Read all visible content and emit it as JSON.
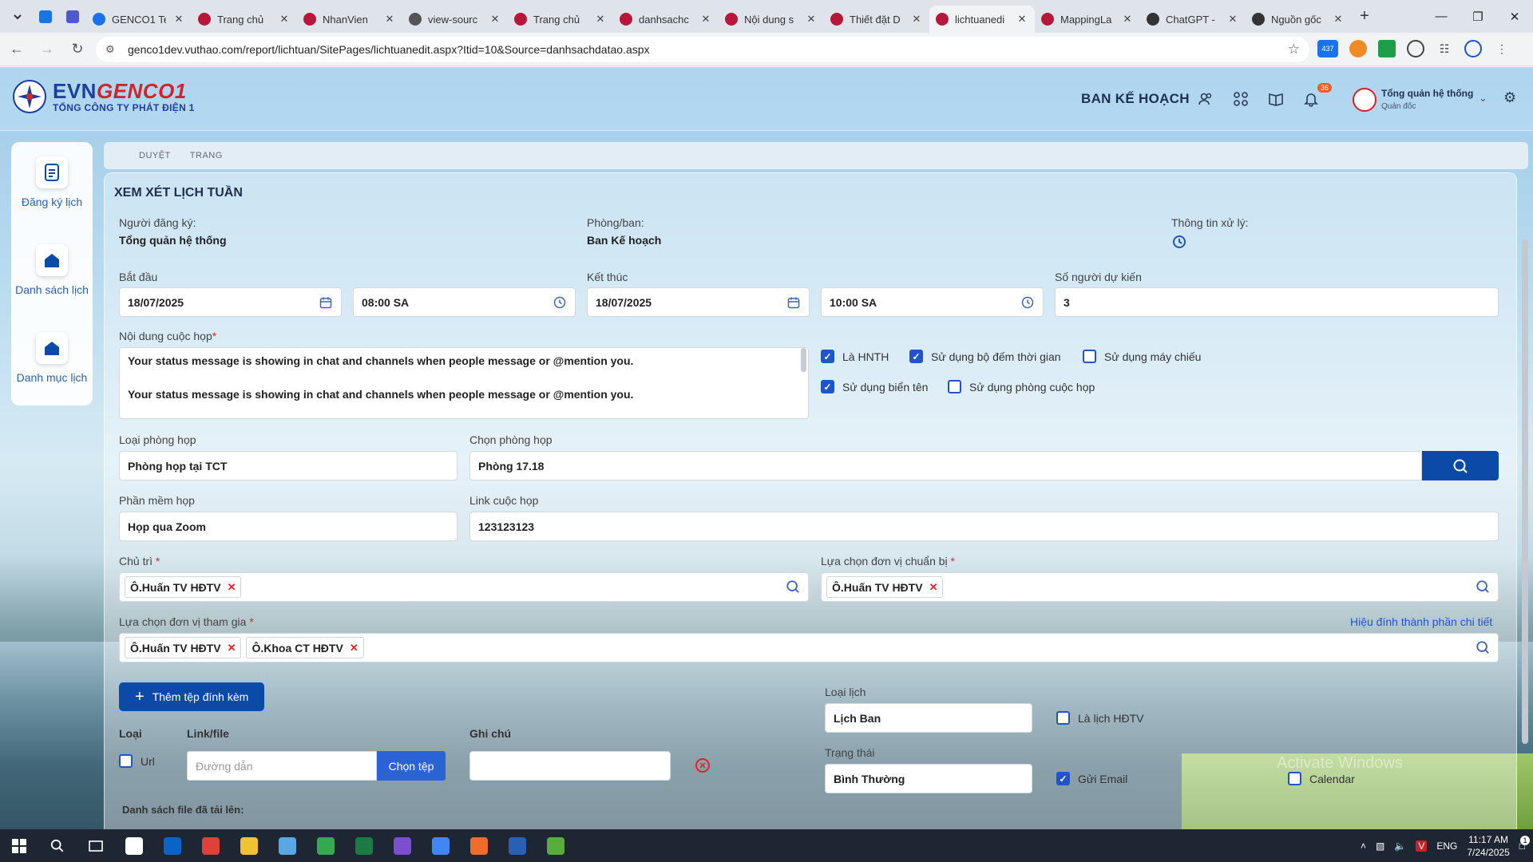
{
  "browser": {
    "tabs": [
      {
        "label": "GENCO1 Te",
        "color": "#1a73e8"
      },
      {
        "label": "Trang chủ",
        "color": "#b7183a"
      },
      {
        "label": "NhanVien",
        "color": "#b7183a"
      },
      {
        "label": "view-sourc",
        "color": "#555555"
      },
      {
        "label": "Trang chủ",
        "color": "#b7183a"
      },
      {
        "label": "danhsachc",
        "color": "#b7183a"
      },
      {
        "label": "Nội dung s",
        "color": "#b7183a"
      },
      {
        "label": "Thiết đặt D",
        "color": "#b7183a"
      },
      {
        "label": "lichtuanedi",
        "color": "#b7183a",
        "active": true
      },
      {
        "label": "MappingLa",
        "color": "#b7183a"
      },
      {
        "label": "ChatGPT -",
        "color": "#333333"
      },
      {
        "label": "Nguồn gốc",
        "color": "#333333"
      }
    ],
    "url": "genco1dev.vuthao.com/report/lichtuan/SitePages/lichtuanedit.aspx?Itid=10&Source=danhsachdatao.aspx",
    "ext_badge": "437"
  },
  "header": {
    "logo_main": "EVN",
    "logo_accent": "GENCO1",
    "logo_sub": "TỔNG CÔNG TY PHÁT ĐIỆN 1",
    "dept_title": "BAN KẾ HOẠCH",
    "notif_count": "36",
    "user_name": "Tổng quản hệ thống",
    "user_role": "Quản đốc"
  },
  "sidebar": {
    "items": [
      {
        "label": "Đăng ký lịch",
        "icon": "document-icon"
      },
      {
        "label": "Danh sách lịch",
        "icon": "home-icon"
      },
      {
        "label": "Danh mục lịch",
        "icon": "home-icon"
      }
    ]
  },
  "breadcrumb": [
    "DUYỆT",
    "TRANG"
  ],
  "form": {
    "title": "XEM XÉT LỊCH TUẦN",
    "registrant_label": "Người đăng ký:",
    "registrant_value": "Tổng quản hệ thống",
    "dept_label": "Phòng/ban:",
    "dept_value": "Ban Kế hoạch",
    "process_label": "Thông tin xử lý:",
    "start_label": "Bắt đầu",
    "start_date": "18/07/2025",
    "start_time": "08:00 SA",
    "end_label": "Kết thúc",
    "end_date": "18/07/2025",
    "end_time": "10:00 SA",
    "attendees_label": "Số người dự kiến",
    "attendees_value": "3",
    "content_label": "Nội dung cuộc họp",
    "content_lines": [
      "Your status message is showing in chat and channels when people message or @mention you.",
      "",
      "Your status message is showing in chat and channels when people message or @mention you."
    ],
    "options": [
      {
        "label": "Là HNTH",
        "checked": true
      },
      {
        "label": "Sử dụng bộ đếm thời gian",
        "checked": true
      },
      {
        "label": "Sử dụng máy chiếu",
        "checked": false
      },
      {
        "label": "Sử dụng biển tên",
        "checked": true
      },
      {
        "label": "Sử dụng phòng cuộc họp",
        "checked": false
      }
    ],
    "room_type_label": "Loại phòng họp",
    "room_type_value": "Phòng họp tại TCT",
    "room_label": "Chọn phòng họp",
    "room_value": "Phòng 17.18",
    "software_label": "Phần mềm họp",
    "software_value": "Họp qua Zoom",
    "link_label": "Link cuộc họp",
    "link_value": "123123123",
    "chair_label": "Chủ trì",
    "chair_tags": [
      "Ô.Huấn TV HĐTV"
    ],
    "prep_label": "Lựa chọn đơn vị chuẩn bị",
    "prep_tags": [
      "Ô.Huấn TV HĐTV"
    ],
    "participants_label": "Lựa chọn đơn vị tham gia",
    "participants_tags": [
      "Ô.Huấn TV HĐTV",
      "Ô.Khoa CT HĐTV"
    ],
    "edit_details_link": "Hiệu đính thành phần chi tiết",
    "add_attachment": "Thêm tệp đính kèm",
    "col_type": "Loại",
    "col_link": "Link/file",
    "col_note": "Ghi chú",
    "url_checkbox": "Url",
    "path_placeholder": "Đường dẫn",
    "choose_file": "Chọn tệp",
    "uploaded_label": "Danh sách file đã tải lên:",
    "schedule_type_label": "Loại lịch",
    "schedule_type_value": "Lịch Ban",
    "board_schedule": "Là lịch HĐTV",
    "status_label": "Trạng thái",
    "status_value": "Bình Thường",
    "send_email": "Gửi Email",
    "calendar": "Calendar"
  },
  "watermark": "Activate Windows",
  "taskbar": {
    "apps": [
      {
        "name": "notion-icon",
        "color": "#ffffff"
      },
      {
        "name": "outlook-icon",
        "color": "#0a64c8"
      },
      {
        "name": "anydesk-icon",
        "color": "#e0403a"
      },
      {
        "name": "file-explorer-icon",
        "color": "#f1c232"
      },
      {
        "name": "app-icon",
        "color": "#5aa7e6"
      },
      {
        "name": "chrome-icon",
        "color": "#34a853"
      },
      {
        "name": "excel-icon",
        "color": "#1d7a45"
      },
      {
        "name": "visual-studio-icon",
        "color": "#7b4fd0"
      },
      {
        "name": "chrome-icon",
        "color": "#4285f4"
      },
      {
        "name": "postman-icon",
        "color": "#ef6c2a"
      },
      {
        "name": "word-icon",
        "color": "#2b5fb4"
      },
      {
        "name": "notepad-icon",
        "color": "#5aad3c"
      }
    ],
    "lang": "ENG",
    "time": "11:17 AM",
    "date": "7/24/2025",
    "notif_count": "1"
  }
}
